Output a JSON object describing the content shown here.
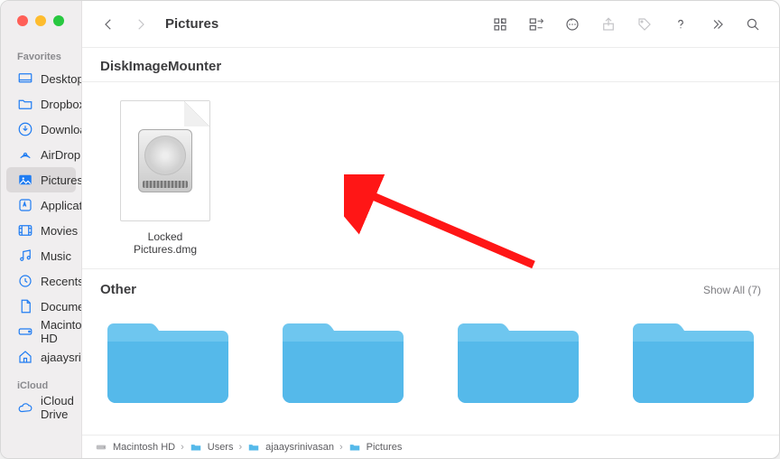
{
  "window": {
    "title": "Pictures"
  },
  "sidebar": {
    "groups": [
      {
        "label": "Favorites"
      },
      {
        "label": "iCloud"
      }
    ],
    "items": [
      {
        "label": "Desktop"
      },
      {
        "label": "Dropbox"
      },
      {
        "label": "Downloads"
      },
      {
        "label": "AirDrop"
      },
      {
        "label": "Pictures"
      },
      {
        "label": "Applications"
      },
      {
        "label": "Movies"
      },
      {
        "label": "Music"
      },
      {
        "label": "Recents"
      },
      {
        "label": "Documents"
      },
      {
        "label": "Macintosh HD"
      },
      {
        "label": "ajaaysrinivasan"
      }
    ],
    "icloud_items": [
      {
        "label": "iCloud Drive"
      }
    ]
  },
  "sections": {
    "s1": {
      "heading": "DiskImageMounter"
    },
    "s2": {
      "heading": "Other",
      "show_all": "Show All (7)"
    }
  },
  "files": {
    "dmg": {
      "name": "Locked Pictures.dmg"
    }
  },
  "pathbar": {
    "p0": "Macintosh HD",
    "p1": "Users",
    "p2": "ajaaysrinivasan",
    "p3": "Pictures"
  }
}
